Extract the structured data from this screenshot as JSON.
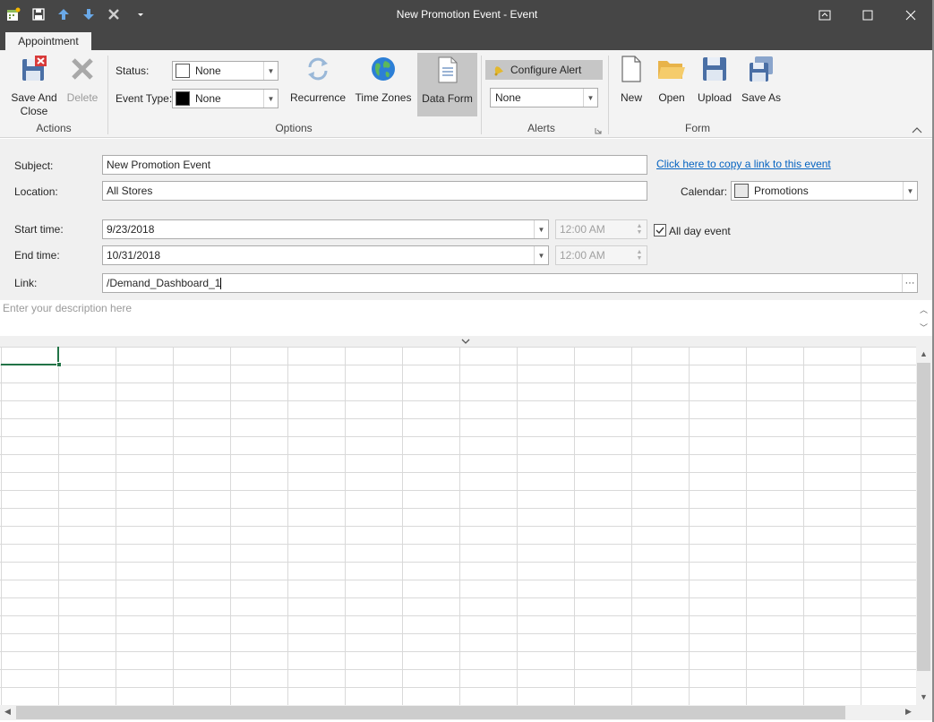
{
  "window": {
    "title": "New Promotion Event - Event"
  },
  "ribbon": {
    "tab": "Appointment",
    "actions": {
      "group_label": "Actions",
      "save_close_line1": "Save And",
      "save_close_line2": "Close",
      "delete": "Delete"
    },
    "options": {
      "group_label": "Options",
      "status_label": "Status:",
      "status_value": "None",
      "status_color": "#ffffff",
      "event_type_label": "Event Type:",
      "event_type_value": "None",
      "event_type_color": "#000000",
      "recurrence": "Recurrence",
      "time_zones": "Time Zones",
      "data_form": "Data Form"
    },
    "alerts": {
      "group_label": "Alerts",
      "configure_alert": "Configure Alert",
      "alert_value": "None"
    },
    "form": {
      "group_label": "Form",
      "new": "New",
      "open": "Open",
      "upload": "Upload",
      "save_as": "Save As"
    }
  },
  "event_form": {
    "subject_label": "Subject:",
    "subject_value": "New Promotion Event",
    "copy_link": "Click here to copy a link to this event",
    "location_label": "Location:",
    "location_value": "All Stores",
    "calendar_label": "Calendar:",
    "calendar_value": "Promotions",
    "start_label": "Start time:",
    "start_date": "9/23/2018",
    "start_time": "12:00 AM",
    "all_day_label": "All day event",
    "all_day_checked": true,
    "end_label": "End time:",
    "end_date": "10/31/2018",
    "end_time": "12:00 AM",
    "link_label": "Link:",
    "link_value": "/Demand_Dashboard_1",
    "description_placeholder": "Enter your description here"
  },
  "colors": {
    "titlebar": "#464646",
    "ribbon": "#f3f3f3",
    "link": "#0563c1",
    "selection": "#217346"
  }
}
